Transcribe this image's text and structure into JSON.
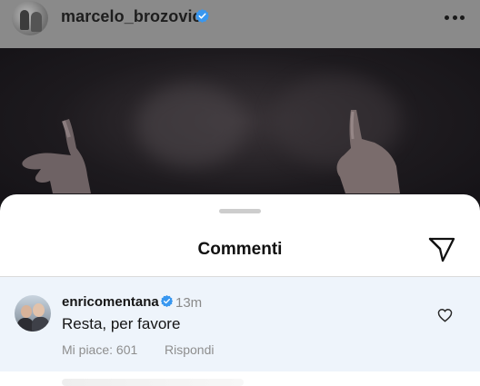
{
  "post": {
    "username": "marcelo_brozovic",
    "verified": true,
    "more_icon": "more-horizontal-icon"
  },
  "sheet": {
    "title": "Commenti",
    "share_icon": "send-icon"
  },
  "comment": {
    "username": "enricomentana",
    "verified": true,
    "time": "13m",
    "text": "Resta, per favore",
    "likes": "Mi piace: 601",
    "reply_label": "Rispondi",
    "like_icon": "heart-outline-icon"
  },
  "colors": {
    "verified_blue": "#3897f0",
    "comment_highlight": "#eef4fb",
    "secondary_text": "#8e8e8e"
  }
}
